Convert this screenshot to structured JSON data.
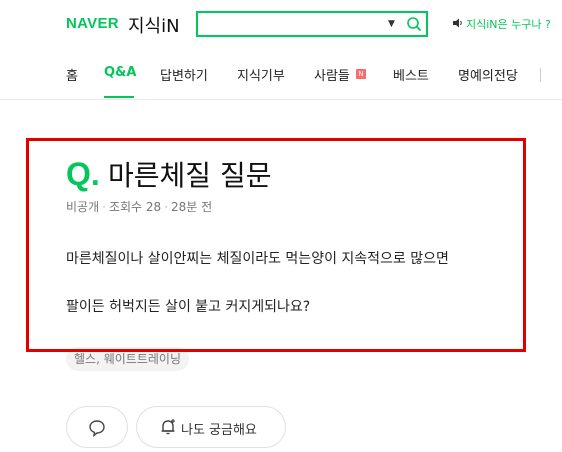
{
  "header": {
    "brand": "NAVER",
    "service": "지식iN",
    "search": {
      "value": "",
      "placeholder": ""
    },
    "notice": "지식iN은 누구나 ?"
  },
  "nav": {
    "items": [
      "홈",
      "Q&A",
      "답변하기",
      "지식기부",
      "사람들",
      "베스트",
      "명예의전당"
    ],
    "active": "Q&A",
    "new_badge": "N"
  },
  "question": {
    "mark": "Q.",
    "title": "마른체질 질문",
    "author": "비공개",
    "views": "조회수 28",
    "time": "28분 전",
    "body_line1": "마른체질이나 살이안찌는 체질이라도 먹는양이 지속적으로 많으면",
    "body_line2": "팔이든 허벅지든 살이 붙고 커지게되나요?",
    "tag": "헬스, 웨이트트레이닝"
  },
  "actions": {
    "curious_label": "나도 궁금해요"
  },
  "colors": {
    "brand": "#03c75a",
    "highlight": "#e00000"
  }
}
